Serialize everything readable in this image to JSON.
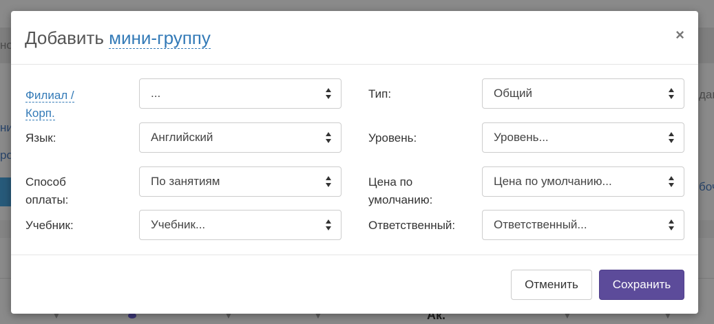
{
  "background": {
    "left_tab_fragment": "но",
    "right_tab_fragment": "дав",
    "left_link_1": "ни",
    "left_link_2": "ро",
    "right_text_fragment": "боч",
    "table_column_fragment": "Ак."
  },
  "modal": {
    "title_prefix": "Добавить",
    "title_link": "мини-группу",
    "close_label": "×"
  },
  "form": {
    "branch": {
      "label_line1": "Филиал /",
      "label_line2": "Корп.",
      "value": "..."
    },
    "type": {
      "label": "Тип:",
      "value": "Общий"
    },
    "language": {
      "label": "Язык:",
      "value": "Английский"
    },
    "level": {
      "label": "Уровень:",
      "value": "Уровень..."
    },
    "payment": {
      "label_line1": "Способ",
      "label_line2": "оплаты:",
      "value": "По занятиям"
    },
    "price": {
      "label_line1": "Цена по",
      "label_line2": "умолчанию:",
      "value": "Цена по умолчанию..."
    },
    "textbook": {
      "label": "Учебник:",
      "value": "Учебник..."
    },
    "responsible": {
      "label": "Ответственный:",
      "value": "Ответственный..."
    }
  },
  "footer": {
    "cancel_label": "Отменить",
    "save_label": "Сохранить"
  },
  "colors": {
    "accent_link": "#337ab7",
    "primary_button": "#5c4b9a"
  }
}
